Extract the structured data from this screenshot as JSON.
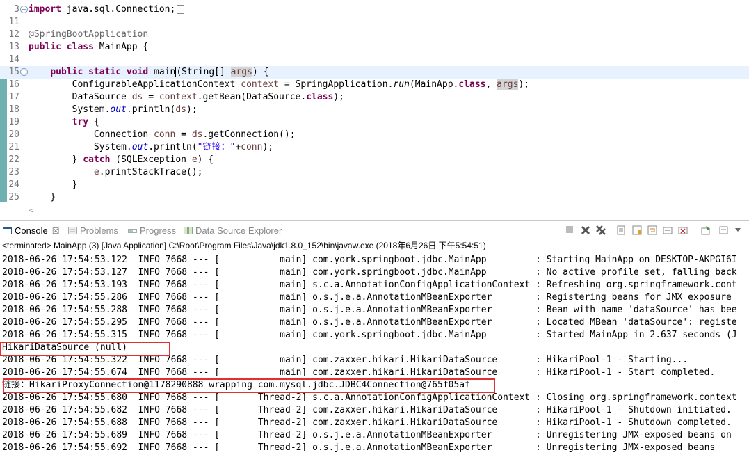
{
  "editor": {
    "lines": [
      {
        "num": "3",
        "fold": "+",
        "segments": [
          {
            "t": "import",
            "c": "kw"
          },
          {
            "t": " java.sql.Connection;",
            "c": ""
          }
        ],
        "collapsed": true
      },
      {
        "num": "11",
        "segments": []
      },
      {
        "num": "12",
        "segments": [
          {
            "t": "@SpringBootApplication",
            "c": "ann"
          }
        ]
      },
      {
        "num": "13",
        "segments": [
          {
            "t": "public",
            "c": "kw"
          },
          {
            "t": " ",
            "c": ""
          },
          {
            "t": "class",
            "c": "kw"
          },
          {
            "t": " MainApp {",
            "c": ""
          }
        ]
      },
      {
        "num": "14",
        "segments": []
      },
      {
        "num": "15",
        "fold": "−",
        "current": true,
        "segments": [
          {
            "t": "    ",
            "c": ""
          },
          {
            "t": "public",
            "c": "kw"
          },
          {
            "t": " ",
            "c": ""
          },
          {
            "t": "static",
            "c": "kw"
          },
          {
            "t": " ",
            "c": ""
          },
          {
            "t": "void",
            "c": "kw"
          },
          {
            "t": " main",
            "c": ""
          },
          {
            "t": "|",
            "c": "cursor"
          },
          {
            "t": "(String[] ",
            "c": ""
          },
          {
            "t": "args",
            "c": "var hl"
          },
          {
            "t": ") {",
            "c": ""
          }
        ]
      },
      {
        "num": "16",
        "segments": [
          {
            "t": "        ConfigurableApplicationContext ",
            "c": ""
          },
          {
            "t": "context",
            "c": "var"
          },
          {
            "t": " = SpringApplication.",
            "c": ""
          },
          {
            "t": "run",
            "c": "static-m"
          },
          {
            "t": "(MainApp.",
            "c": ""
          },
          {
            "t": "class",
            "c": "kw"
          },
          {
            "t": ", ",
            "c": ""
          },
          {
            "t": "args",
            "c": "var hl"
          },
          {
            "t": ");",
            "c": ""
          }
        ]
      },
      {
        "num": "17",
        "segments": [
          {
            "t": "        DataSource ",
            "c": ""
          },
          {
            "t": "ds",
            "c": "var"
          },
          {
            "t": " = ",
            "c": ""
          },
          {
            "t": "context",
            "c": "var"
          },
          {
            "t": ".getBean(DataSource.",
            "c": ""
          },
          {
            "t": "class",
            "c": "kw"
          },
          {
            "t": ");",
            "c": ""
          }
        ]
      },
      {
        "num": "18",
        "segments": [
          {
            "t": "        System.",
            "c": ""
          },
          {
            "t": "out",
            "c": "fld"
          },
          {
            "t": ".println(",
            "c": ""
          },
          {
            "t": "ds",
            "c": "var"
          },
          {
            "t": ");",
            "c": ""
          }
        ]
      },
      {
        "num": "19",
        "segments": [
          {
            "t": "        ",
            "c": ""
          },
          {
            "t": "try",
            "c": "kw"
          },
          {
            "t": " {",
            "c": ""
          }
        ]
      },
      {
        "num": "20",
        "segments": [
          {
            "t": "            Connection ",
            "c": ""
          },
          {
            "t": "conn",
            "c": "var"
          },
          {
            "t": " = ",
            "c": ""
          },
          {
            "t": "ds",
            "c": "var"
          },
          {
            "t": ".getConnection();",
            "c": ""
          }
        ]
      },
      {
        "num": "21",
        "segments": [
          {
            "t": "            System.",
            "c": ""
          },
          {
            "t": "out",
            "c": "fld"
          },
          {
            "t": ".println(",
            "c": ""
          },
          {
            "t": "\"链接：\"",
            "c": "str"
          },
          {
            "t": "+",
            "c": ""
          },
          {
            "t": "conn",
            "c": "var"
          },
          {
            "t": ");",
            "c": ""
          }
        ]
      },
      {
        "num": "22",
        "segments": [
          {
            "t": "        } ",
            "c": ""
          },
          {
            "t": "catch",
            "c": "kw"
          },
          {
            "t": " (SQLException ",
            "c": ""
          },
          {
            "t": "e",
            "c": "var"
          },
          {
            "t": ") {",
            "c": ""
          }
        ]
      },
      {
        "num": "23",
        "segments": [
          {
            "t": "            ",
            "c": ""
          },
          {
            "t": "e",
            "c": "var"
          },
          {
            "t": ".printStackTrace();",
            "c": ""
          }
        ]
      },
      {
        "num": "24",
        "segments": [
          {
            "t": "        }",
            "c": ""
          }
        ]
      },
      {
        "num": "25",
        "segments": [
          {
            "t": "    }",
            "c": ""
          }
        ]
      }
    ],
    "hscroll_glyph": "<"
  },
  "tabs": {
    "console": "Console",
    "close": "☒",
    "problems": "Problems",
    "progress": "Progress",
    "datasource": "Data Source Explorer"
  },
  "toolbar_icons": [
    "stop-icon",
    "remove-launch-icon",
    "remove-all-icon",
    "clear-console-icon",
    "scroll-lock-icon",
    "word-wrap-icon",
    "show-on-output-icon",
    "show-on-error-icon",
    "pin-console-icon",
    "display-console-icon",
    "view-menu-icon"
  ],
  "status_line": "<terminated> MainApp (3) [Java Application] C:\\Root\\Program Files\\Java\\jdk1.8.0_152\\bin\\javaw.exe (2018年6月26日 下午5:54:51)",
  "console_lines": [
    "2018-06-26 17:54:53.122  INFO 7668 --- [           main] com.york.springboot.jdbc.MainApp         : Starting MainApp on DESKTOP-AKPGI6I",
    "2018-06-26 17:54:53.127  INFO 7668 --- [           main] com.york.springboot.jdbc.MainApp         : No active profile set, falling back",
    "2018-06-26 17:54:53.193  INFO 7668 --- [           main] s.c.a.AnnotationConfigApplicationContext : Refreshing org.springframework.cont",
    "2018-06-26 17:54:55.286  INFO 7668 --- [           main] o.s.j.e.a.AnnotationMBeanExporter        : Registering beans for JMX exposure",
    "2018-06-26 17:54:55.288  INFO 7668 --- [           main] o.s.j.e.a.AnnotationMBeanExporter        : Bean with name 'dataSource' has bee",
    "2018-06-26 17:54:55.295  INFO 7668 --- [           main] o.s.j.e.a.AnnotationMBeanExporter        : Located MBean 'dataSource': registe",
    "2018-06-26 17:54:55.315  INFO 7668 --- [           main] com.york.springboot.jdbc.MainApp         : Started MainApp in 2.637 seconds (J",
    "HikariDataSource (null)",
    "2018-06-26 17:54:55.322  INFO 7668 --- [           main] com.zaxxer.hikari.HikariDataSource       : HikariPool-1 - Starting...",
    "2018-06-26 17:54:55.674  INFO 7668 --- [           main] com.zaxxer.hikari.HikariDataSource       : HikariPool-1 - Start completed.",
    "链接：HikariProxyConnection@1178290888 wrapping com.mysql.jdbc.JDBC4Connection@765f05af",
    "2018-06-26 17:54:55.680  INFO 7668 --- [       Thread-2] s.c.a.AnnotationConfigApplicationContext : Closing org.springframework.context",
    "2018-06-26 17:54:55.682  INFO 7668 --- [       Thread-2] com.zaxxer.hikari.HikariDataSource       : HikariPool-1 - Shutdown initiated.",
    "2018-06-26 17:54:55.688  INFO 7668 --- [       Thread-2] com.zaxxer.hikari.HikariDataSource       : HikariPool-1 - Shutdown completed.",
    "2018-06-26 17:54:55.689  INFO 7668 --- [       Thread-2] o.s.j.e.a.AnnotationMBeanExporter        : Unregistering JMX-exposed beans on",
    "2018-06-26 17:54:55.692  INFO 7668 --- [       Thread-2] o.s.j.e.a.AnnotationMBeanExporter        : Unregistering JMX-exposed beans"
  ],
  "highlight_color": "#e03030"
}
